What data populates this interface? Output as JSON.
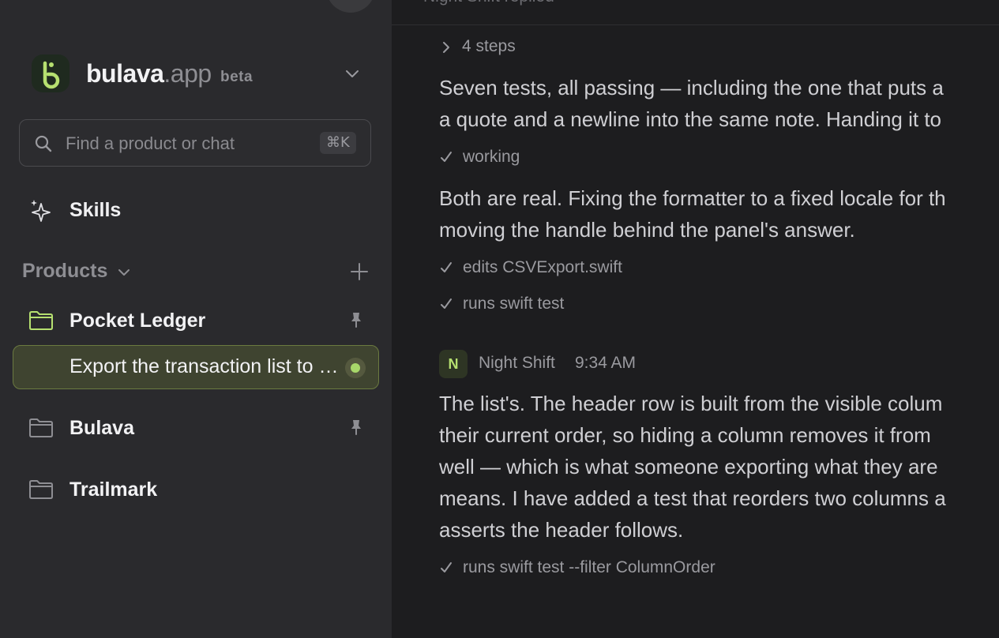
{
  "sidebar": {
    "brand": {
      "name_primary": "bulava",
      "name_suffix": ".app",
      "badge": "beta"
    },
    "search": {
      "placeholder": "Find a product or chat",
      "shortcut": "⌘K"
    },
    "skills_label": "Skills",
    "products_label": "Products",
    "projects": [
      {
        "name": "Pocket Ledger",
        "pinned": true,
        "folder_color": "#b6e070"
      },
      {
        "name": "Bulava",
        "pinned": true,
        "folder_color": "#8e8e93"
      },
      {
        "name": "Trailmark",
        "pinned": false,
        "folder_color": "#8e8e93"
      }
    ],
    "active_chat": {
      "title": "Export the transaction list to CSV",
      "status": "active"
    }
  },
  "main": {
    "top_text": "Night Shift replied",
    "steps_label": "4 steps",
    "para1": [
      "Seven tests, all passing — including the one that puts a",
      "a quote and a newline into the same note. Handing it to"
    ],
    "tool1": "working",
    "para2": [
      "Both are real. Fixing the formatter to a fixed locale for th",
      "moving the handle behind the panel's answer."
    ],
    "tool2": "edits CSVExport.swift",
    "tool3": "runs swift test",
    "message": {
      "avatar_letter": "N",
      "author": "Night Shift",
      "time": "9:34 AM",
      "lines": [
        "The list's. The header row is built from the visible colum",
        "their current order, so hiding a column removes it from",
        "well — which is what someone exporting what they are",
        "means. I have added a test that reorders two columns a",
        "asserts the header follows."
      ]
    },
    "tool4": "runs swift test --filter ColumnOrder"
  },
  "colors": {
    "accent": "#b6e070",
    "sidebar_bg": "#2a2a2d",
    "main_bg": "#1d1d1f",
    "active_item_bg": "#3f4430",
    "status_dot": "#a8d86a"
  }
}
